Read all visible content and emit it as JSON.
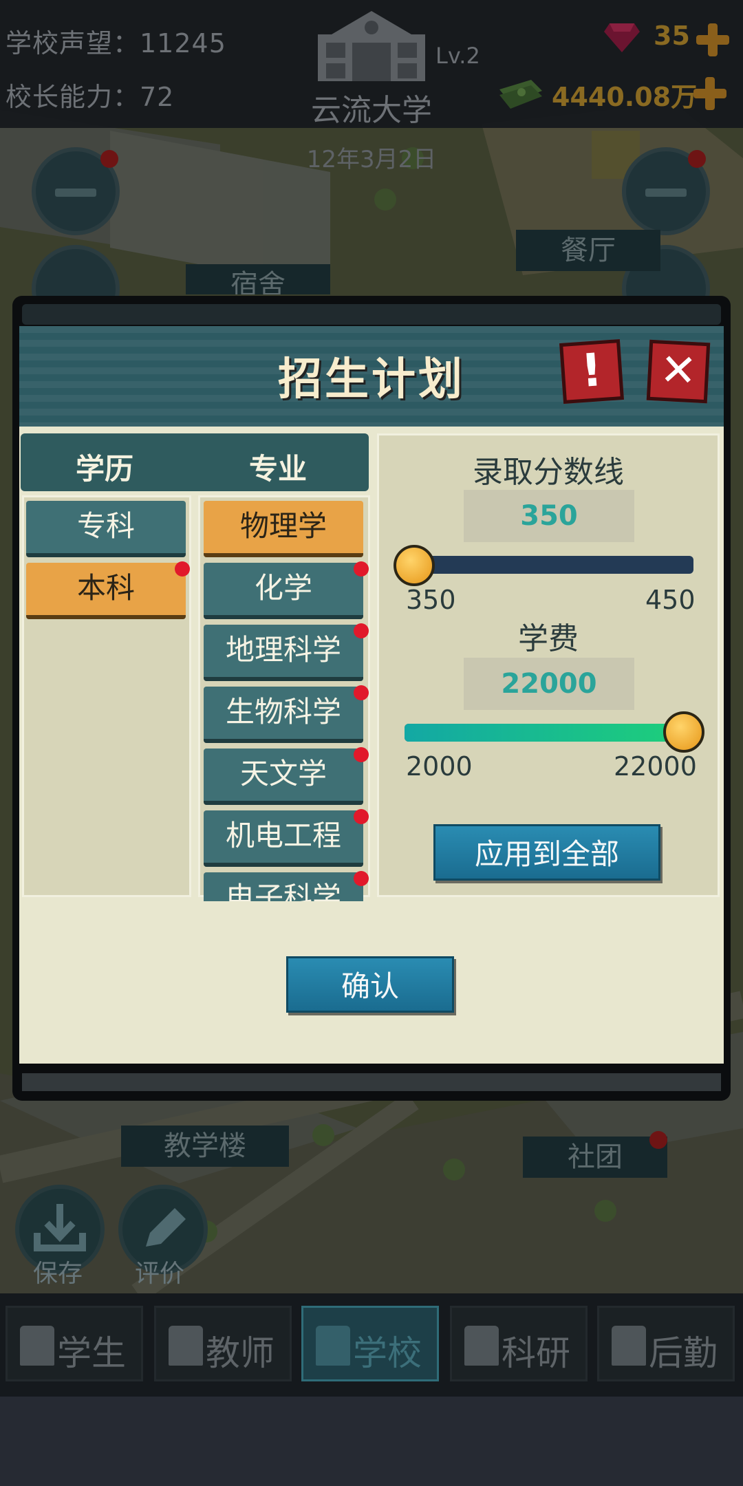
{
  "hud": {
    "prestige": "学校声望：11245",
    "ability": "校长能力：72",
    "school_name": "云流大学",
    "level": "Lv.2",
    "gems": "35",
    "money": "4440.08万",
    "date": "12年3月2日"
  },
  "map_signs": {
    "dorm": "宿舍",
    "canteen": "餐厅",
    "teaching": "教学楼",
    "club": "社团"
  },
  "modal": {
    "title": "招生计划",
    "info_glyph": "!",
    "close_glyph": "✕",
    "col_degree": "学历",
    "col_major": "专业",
    "degrees": [
      {
        "label": "专科",
        "selected": false,
        "alert": false
      },
      {
        "label": "本科",
        "selected": true,
        "alert": true
      }
    ],
    "majors": [
      {
        "label": "物理学",
        "selected": true,
        "alert": false
      },
      {
        "label": "化学",
        "selected": false,
        "alert": true
      },
      {
        "label": "地理科学",
        "selected": false,
        "alert": true
      },
      {
        "label": "生物科学",
        "selected": false,
        "alert": true
      },
      {
        "label": "天文学",
        "selected": false,
        "alert": true
      },
      {
        "label": "机电工程",
        "selected": false,
        "alert": true
      },
      {
        "label": "电子科学",
        "selected": false,
        "alert": true
      }
    ],
    "score": {
      "label": "录取分数线",
      "value": "350",
      "min": "350",
      "max": "450",
      "fraction": 0.0
    },
    "fee": {
      "label": "学费",
      "value": "22000",
      "min": "2000",
      "max": "22000",
      "fraction": 1.0
    },
    "apply_all": "应用到全部",
    "confirm": "确认"
  },
  "tools": {
    "save": "保存",
    "rate": "评价"
  },
  "nav": {
    "students": "学生",
    "teachers": "教师",
    "school": "学校",
    "research": "科研",
    "logistics": "后勤"
  },
  "colors": {
    "accent_orange": "#e8a347",
    "accent_teal": "#2aa49a",
    "slider_track": "#233a55",
    "fee_track": "#18c98a",
    "alert_red": "#e1192b",
    "close_red": "#b3252a"
  }
}
